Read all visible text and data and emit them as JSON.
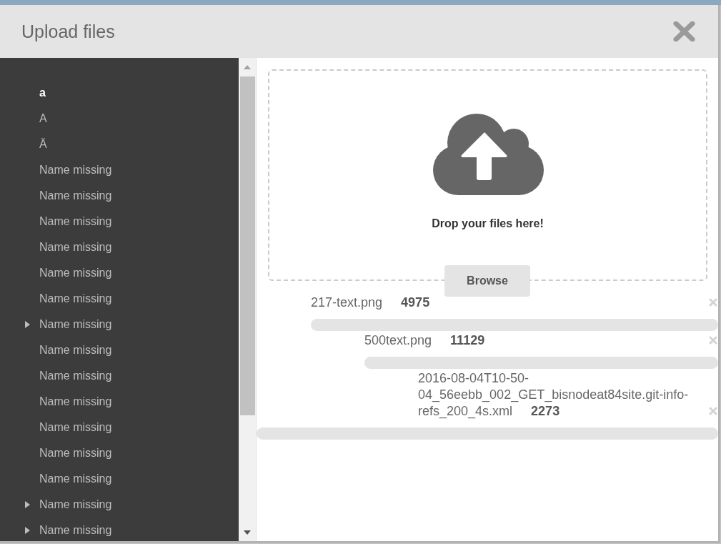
{
  "dialog": {
    "title": "Upload files"
  },
  "sidebar": {
    "items": [
      {
        "label": "a",
        "selected": true,
        "expandable": false
      },
      {
        "label": "A",
        "selected": false,
        "expandable": false
      },
      {
        "label": "Ä",
        "selected": false,
        "expandable": false
      },
      {
        "label": "Name missing",
        "selected": false,
        "expandable": false
      },
      {
        "label": "Name missing",
        "selected": false,
        "expandable": false
      },
      {
        "label": "Name missing",
        "selected": false,
        "expandable": false
      },
      {
        "label": "Name missing",
        "selected": false,
        "expandable": false
      },
      {
        "label": "Name missing",
        "selected": false,
        "expandable": false
      },
      {
        "label": "Name missing",
        "selected": false,
        "expandable": false
      },
      {
        "label": "Name missing",
        "selected": false,
        "expandable": true
      },
      {
        "label": "Name missing",
        "selected": false,
        "expandable": false
      },
      {
        "label": "Name missing",
        "selected": false,
        "expandable": false
      },
      {
        "label": "Name missing",
        "selected": false,
        "expandable": false
      },
      {
        "label": "Name missing",
        "selected": false,
        "expandable": false
      },
      {
        "label": "Name missing",
        "selected": false,
        "expandable": false
      },
      {
        "label": "Name missing",
        "selected": false,
        "expandable": false
      },
      {
        "label": "Name missing",
        "selected": false,
        "expandable": true
      },
      {
        "label": "Name missing",
        "selected": false,
        "expandable": true
      }
    ]
  },
  "dropzone": {
    "prompt": "Drop your files here!",
    "button": "Browse"
  },
  "files": [
    {
      "name": "217-text.png",
      "size": "4975",
      "level": 0
    },
    {
      "name": "500text.png",
      "size": "11129",
      "level": 0
    },
    {
      "name": "2016-08-04T10-50-04_56eebb_002_GET_bisnodeat84site.git-info-refs_200_4s.xml",
      "size": "2273",
      "level": 0
    }
  ]
}
